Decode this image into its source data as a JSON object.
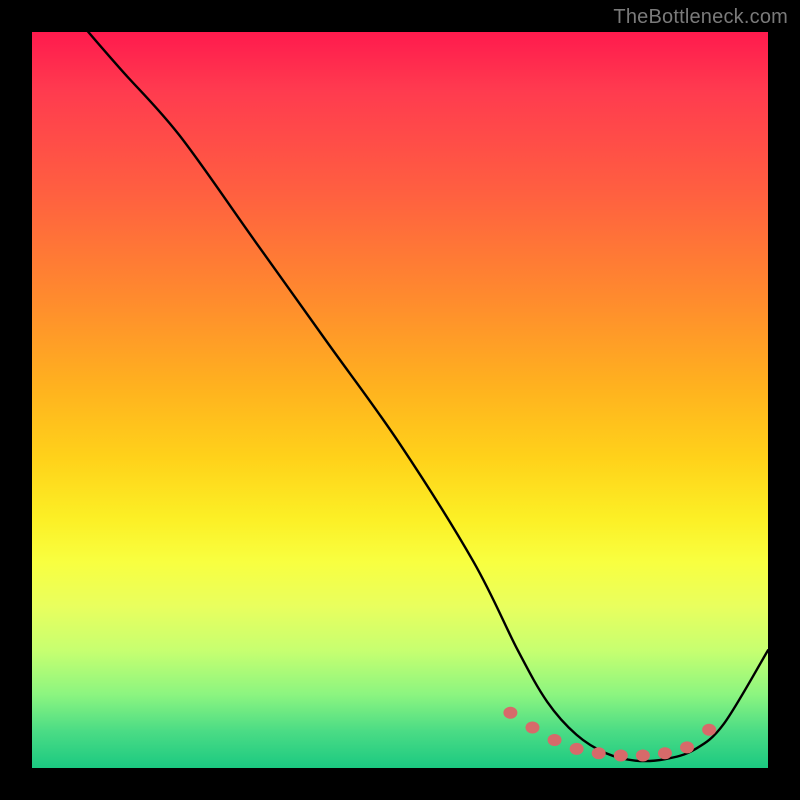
{
  "watermark": "TheBottleneck.com",
  "chart_data": {
    "type": "line",
    "title": "",
    "xlabel": "",
    "ylabel": "",
    "xlim": [
      0,
      100
    ],
    "ylim": [
      0,
      100
    ],
    "grid": false,
    "legend": false,
    "series": [
      {
        "name": "curve",
        "x": [
          0,
          6,
          12,
          20,
          30,
          40,
          50,
          60,
          66,
          70,
          74,
          78,
          82,
          86,
          90,
          94,
          100
        ],
        "y": [
          110,
          102,
          95,
          86,
          72,
          58,
          44,
          28,
          16,
          9,
          4.5,
          2,
          1,
          1.2,
          2.5,
          6,
          16
        ]
      }
    ],
    "markers": {
      "name": "bottom-dots",
      "x": [
        65,
        68,
        71,
        74,
        77,
        80,
        83,
        86,
        89,
        92
      ],
      "y": [
        7.5,
        5.5,
        3.8,
        2.6,
        2.0,
        1.7,
        1.7,
        2.0,
        2.8,
        5.2
      ]
    },
    "colors": {
      "curve": "#000000",
      "markers": "#d76a6a",
      "gradient_top": "#ff1a4d",
      "gradient_bottom": "#1bc981"
    }
  }
}
